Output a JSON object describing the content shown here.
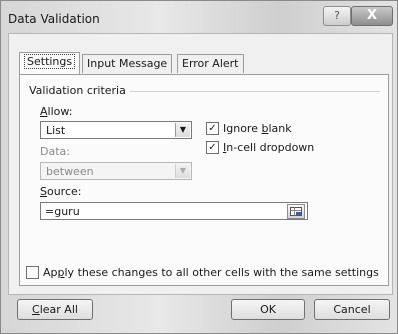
{
  "window": {
    "title": "Data Validation",
    "help_label": "?",
    "close_label": "X"
  },
  "tabs": [
    {
      "label": "Settings"
    },
    {
      "label": "Input Message"
    },
    {
      "label": "Error Alert"
    }
  ],
  "validation_criteria": {
    "group_label": "Validation criteria",
    "allow": {
      "label_pre": "",
      "label_key": "A",
      "label_post": "llow:",
      "value": "List"
    },
    "data": {
      "label": "Data:",
      "value": "between"
    },
    "ignore_blank": {
      "label_pre": "Ignore ",
      "label_key": "b",
      "label_post": "lank",
      "checked": true
    },
    "in_cell_dropdown": {
      "label_pre": "",
      "label_key": "I",
      "label_post": "n-cell dropdown",
      "checked": true
    },
    "source": {
      "label_pre": "",
      "label_key": "S",
      "label_post": "ource:",
      "value": "=guru"
    }
  },
  "apply_all": {
    "label_pre": "Ap",
    "label_key": "p",
    "label_post": "ly these changes to all other cells with the same settings",
    "checked": false
  },
  "footer": {
    "clear_all_pre": "",
    "clear_all_key": "C",
    "clear_all_post": "lear All",
    "ok_label": "OK",
    "cancel_label": "Cancel"
  }
}
